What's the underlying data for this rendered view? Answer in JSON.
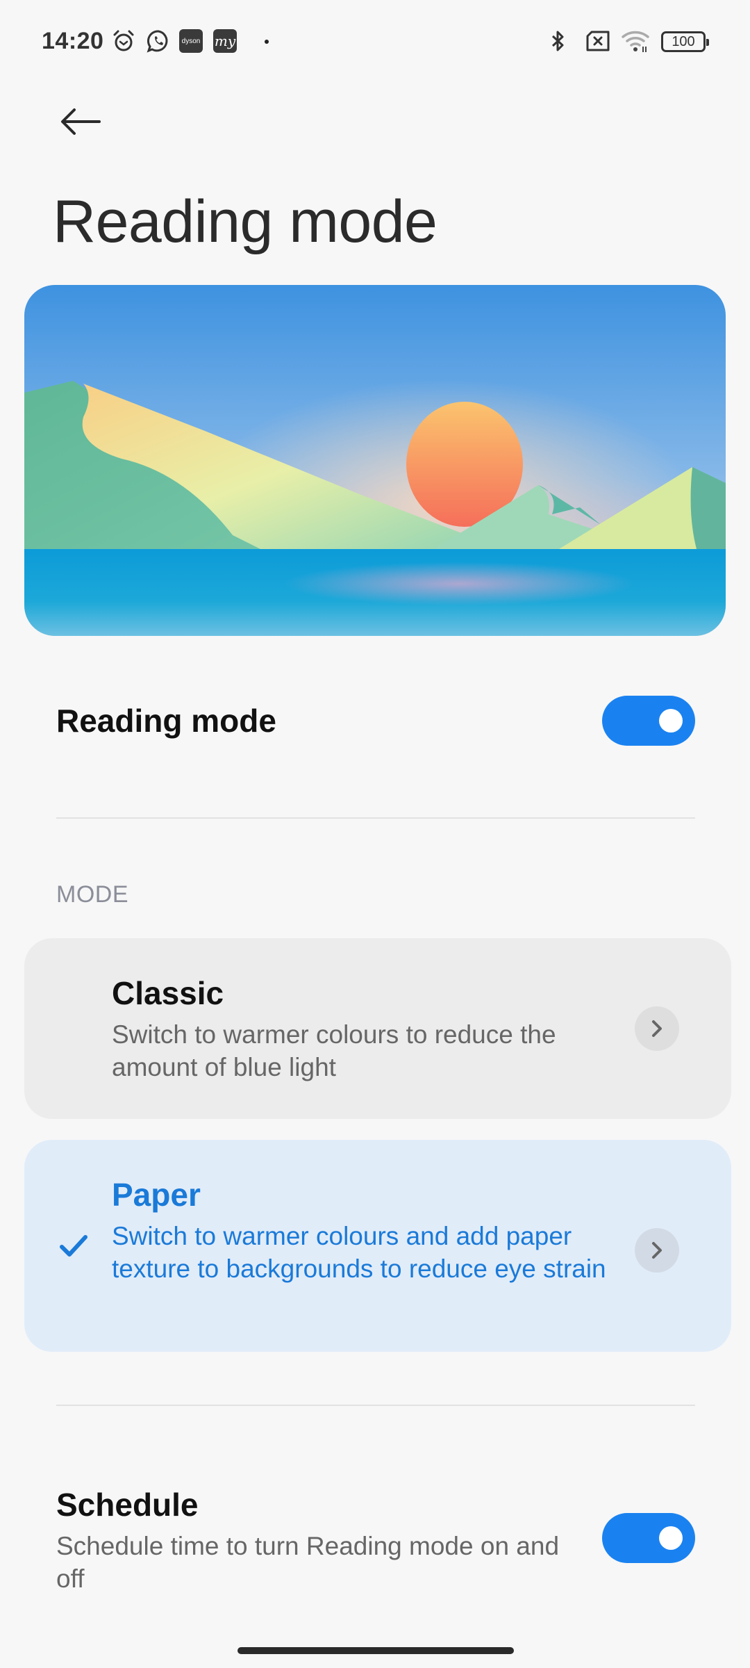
{
  "status_bar": {
    "time": "14:20",
    "left_icons": [
      "alarm-icon",
      "whatsapp-icon",
      "dyson-app-icon",
      "my-app-icon",
      "notification-dot"
    ],
    "dyson_label": "dyson",
    "my_label": "my",
    "right_icons": [
      "bluetooth-icon",
      "no-sim-icon",
      "wifi-icon",
      "battery-icon"
    ],
    "battery_level": "100"
  },
  "header": {
    "back_icon": "arrow-left-icon",
    "title": "Reading mode"
  },
  "banner": {
    "description": "Illustration of sunset over mountains and lake"
  },
  "reading_mode_toggle": {
    "label": "Reading mode",
    "enabled": true
  },
  "mode_section": {
    "label": "MODE",
    "options": [
      {
        "title": "Classic",
        "description": "Switch to warmer colours to reduce the amount of blue light",
        "selected": false
      },
      {
        "title": "Paper",
        "description": "Switch to warmer colours and add paper texture to backgrounds to reduce eye strain",
        "selected": true
      }
    ]
  },
  "schedule": {
    "label": "Schedule",
    "description": "Schedule time to turn Reading mode on and off",
    "enabled": true
  },
  "colors": {
    "accent": "#1a82f0",
    "selected_text": "#1a7ad8",
    "selected_card_bg": "#e1ecf9",
    "card_bg": "#ececec",
    "background": "#f7f7f7"
  }
}
